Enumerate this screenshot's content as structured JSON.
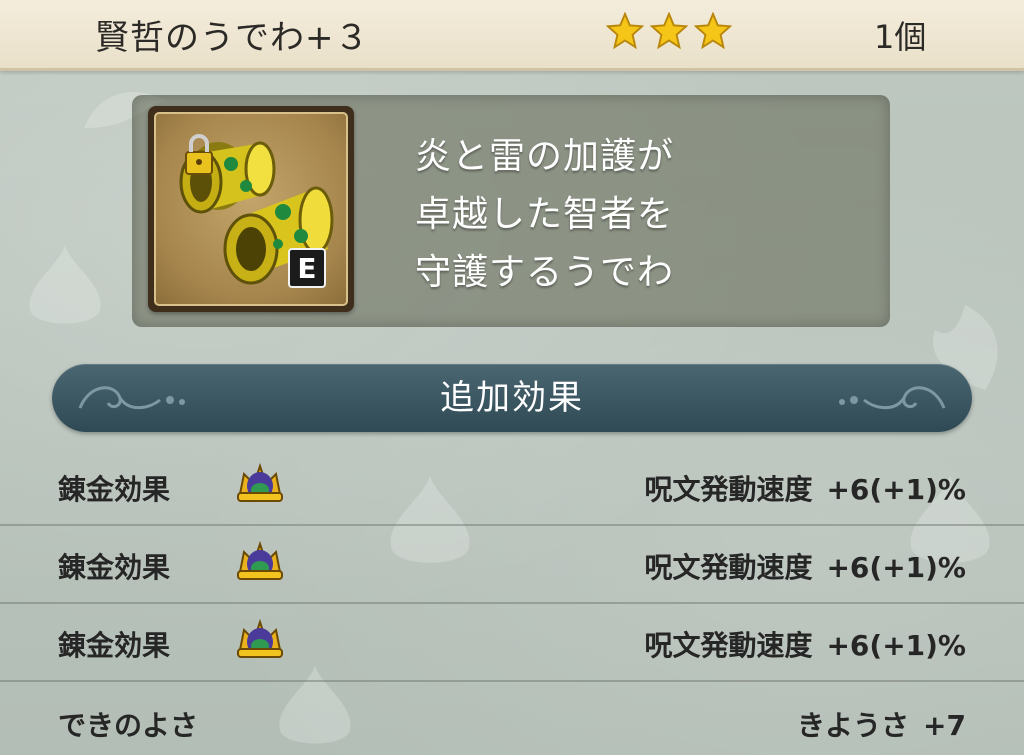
{
  "item": {
    "name": "賢哲のうでわ+３",
    "star_count": 3,
    "count": "1個",
    "equipped_badge": "E",
    "icon": "gold-bracelet-icon",
    "locked": true
  },
  "description": {
    "lines": [
      "炎と雷の加護が",
      "卓越した智者を",
      "守護するうでわ"
    ]
  },
  "effects": {
    "title": "追加効果",
    "rows": [
      {
        "label": "錬金効果",
        "icon": "crown-icon",
        "stat": "呪文発動速度",
        "amount": "+6(+1)%"
      },
      {
        "label": "錬金効果",
        "icon": "crown-icon",
        "stat": "呪文発動速度",
        "amount": "+6(+1)%"
      },
      {
        "label": "錬金効果",
        "icon": "crown-icon",
        "stat": "呪文発動速度",
        "amount": "+6(+1)%"
      }
    ]
  },
  "quality": {
    "label": "できのよさ",
    "stat": "きようさ",
    "amount": "+7"
  },
  "colors": {
    "header_bg": "#f1ead7",
    "banner_bg": "#3a5661",
    "star": "#f5c518",
    "panel_bg": "#6d725c"
  }
}
